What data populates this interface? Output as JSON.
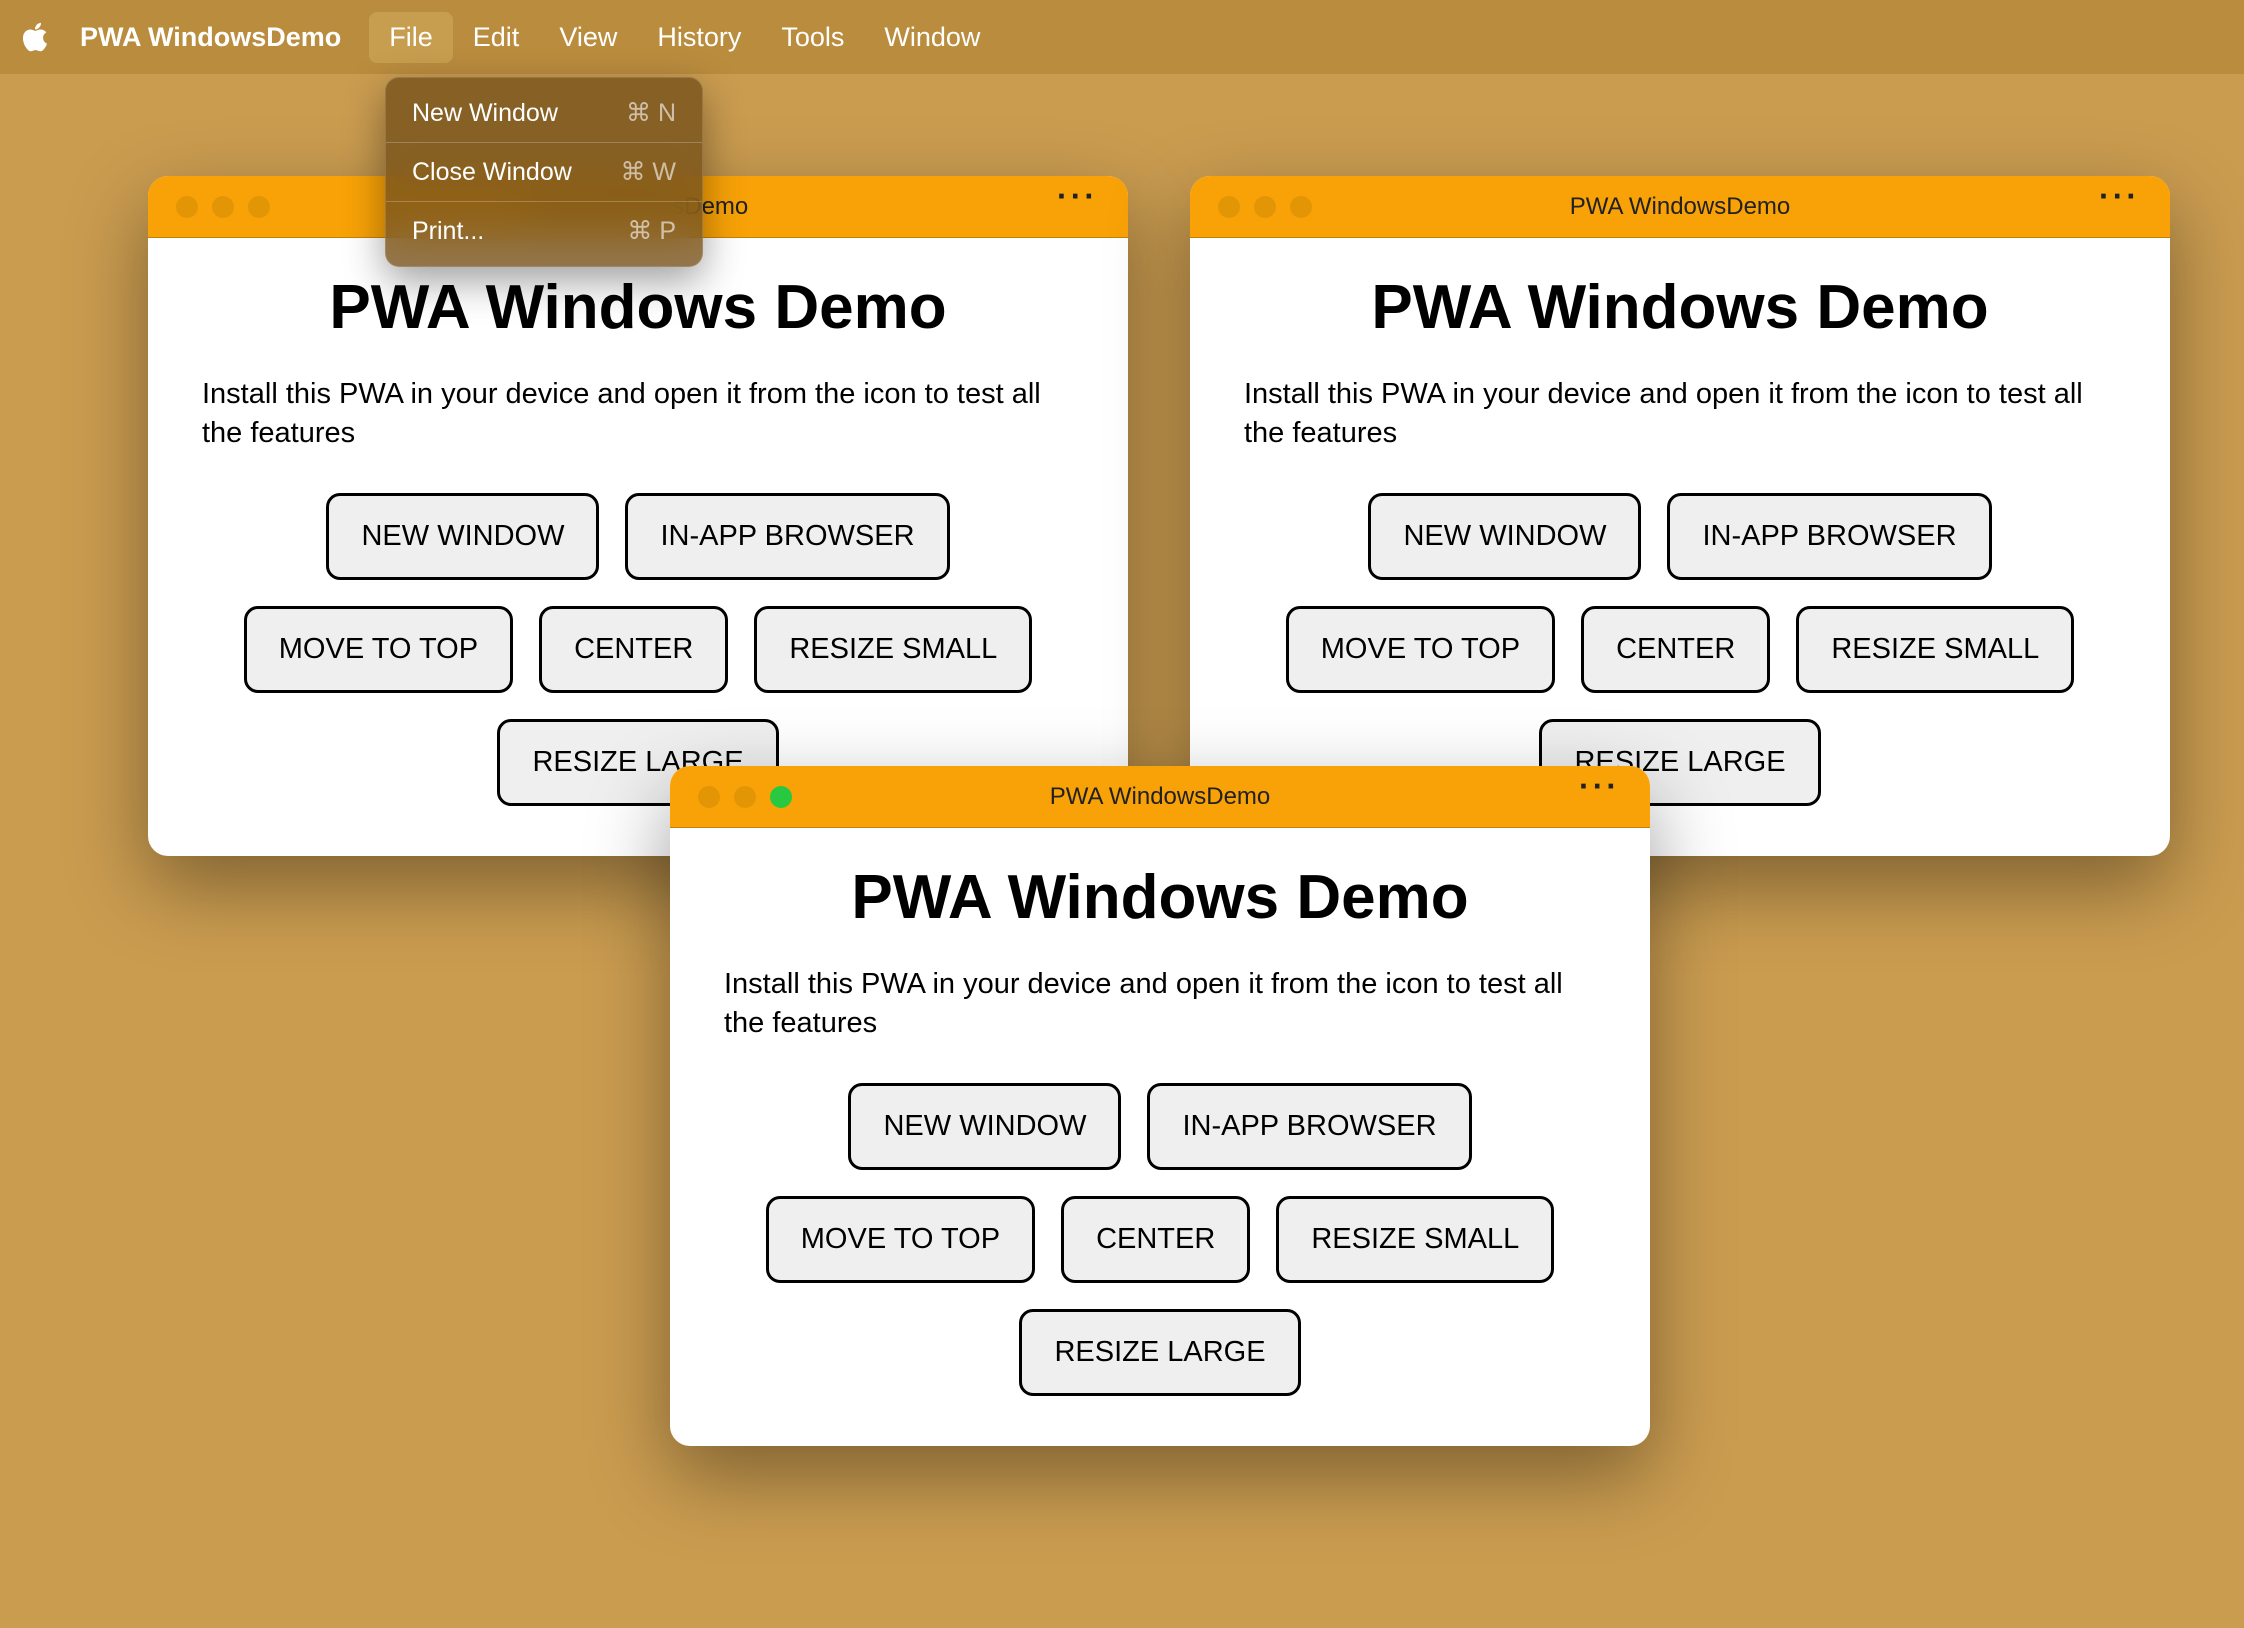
{
  "menubar": {
    "app_name": "PWA WindowsDemo",
    "items": [
      "File",
      "Edit",
      "View",
      "History",
      "Tools",
      "Window"
    ],
    "active_index": 0
  },
  "dropdown": {
    "items": [
      {
        "label": "New Window",
        "shortcut": "⌘ N"
      },
      {
        "label": "Close Window",
        "shortcut": "⌘ W"
      },
      {
        "label": "Print...",
        "shortcut": "⌘ P"
      }
    ]
  },
  "windows": [
    {
      "title": "PWA WindowsDemo",
      "active": false
    },
    {
      "title": "PWA WindowsDemo",
      "active": false
    },
    {
      "title": "PWA WindowsDemo",
      "active": true
    }
  ],
  "content": {
    "title": "PWA Windows Demo",
    "description": "Install this PWA in your device and open it from the icon to test all the features",
    "buttons": [
      "NEW WINDOW",
      "IN-APP BROWSER",
      "MOVE TO TOP",
      "CENTER",
      "RESIZE SMALL",
      "RESIZE LARGE"
    ]
  }
}
